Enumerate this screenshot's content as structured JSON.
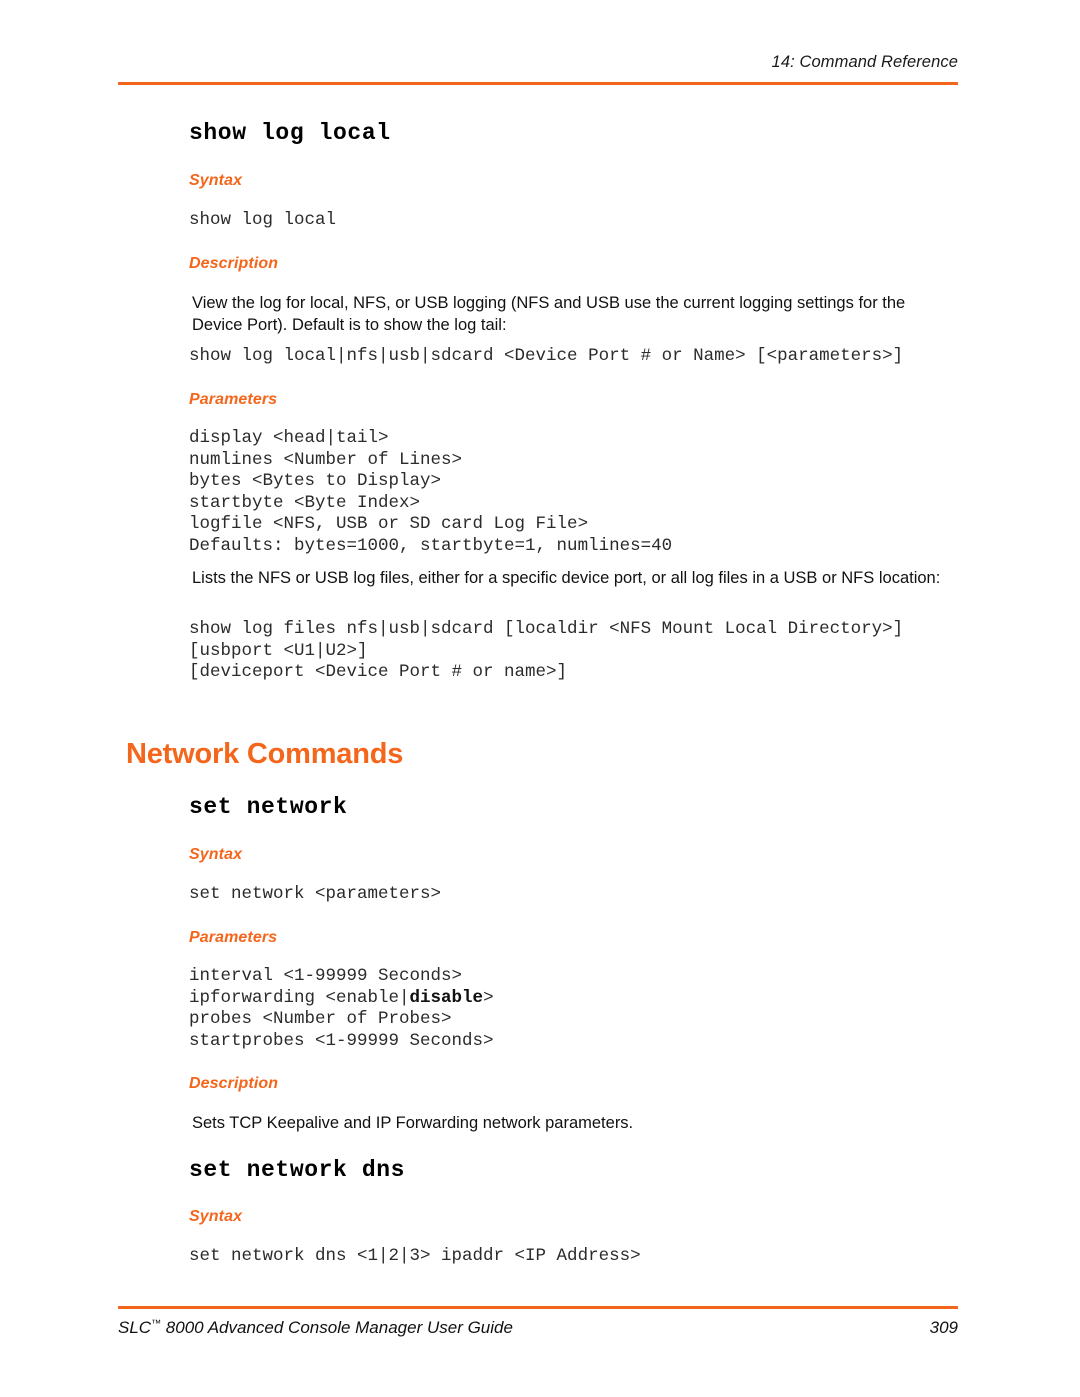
{
  "page": {
    "header_text": "14: Command Reference",
    "rule_color": "#F4661B",
    "footer_title": "SLC™ 8000 Advanced Console Manager User Guide",
    "footer_page_number": "309"
  },
  "labels": {
    "syntax": "Syntax",
    "description": "Description",
    "parameters": "Parameters"
  },
  "commands": {
    "show_log_local": {
      "heading": "show log local",
      "syntax": "show log local",
      "description_paragraph": "View the log for local, NFS, or USB logging (NFS and USB use the current logging settings for the Device Port).  Default is to show the log tail:",
      "description_syntax": "show log local|nfs|usb|sdcard <Device Port # or Name> [<parameters>]",
      "parameters_block": "display <head|tail>\nnumlines <Number of Lines>\nbytes <Bytes to Display>\nstartbyte <Byte Index>\nlogfile <NFS, USB or SD card Log File>\nDefaults: bytes=1000, startbyte=1, numlines=40",
      "list_paragraph": "Lists the NFS or USB log files, either for a specific device port, or all log files in a USB or NFS location:",
      "list_syntax": "show log files nfs|usb|sdcard [localdir <NFS Mount Local Directory>]\n[usbport <U1|U2>]\n[deviceport <Device Port # or name>]"
    },
    "set_network": {
      "heading": "set network",
      "syntax": "set network <parameters>",
      "parameters_line_1": "interval <1-99999 Seconds>",
      "parameters_line_2_prefix": "ipforwarding <enable|",
      "parameters_line_2_bold": "disable",
      "parameters_line_2_suffix": ">",
      "parameters_line_3": "probes <Number of Probes>",
      "parameters_line_4": "startprobes <1-99999 Seconds>",
      "description_paragraph": "Sets TCP Keepalive and IP Forwarding network parameters."
    },
    "set_network_dns": {
      "heading": "set network dns",
      "syntax": "set network dns <1|2|3> ipaddr <IP Address>"
    }
  },
  "sections": {
    "network_commands": "Network Commands"
  }
}
